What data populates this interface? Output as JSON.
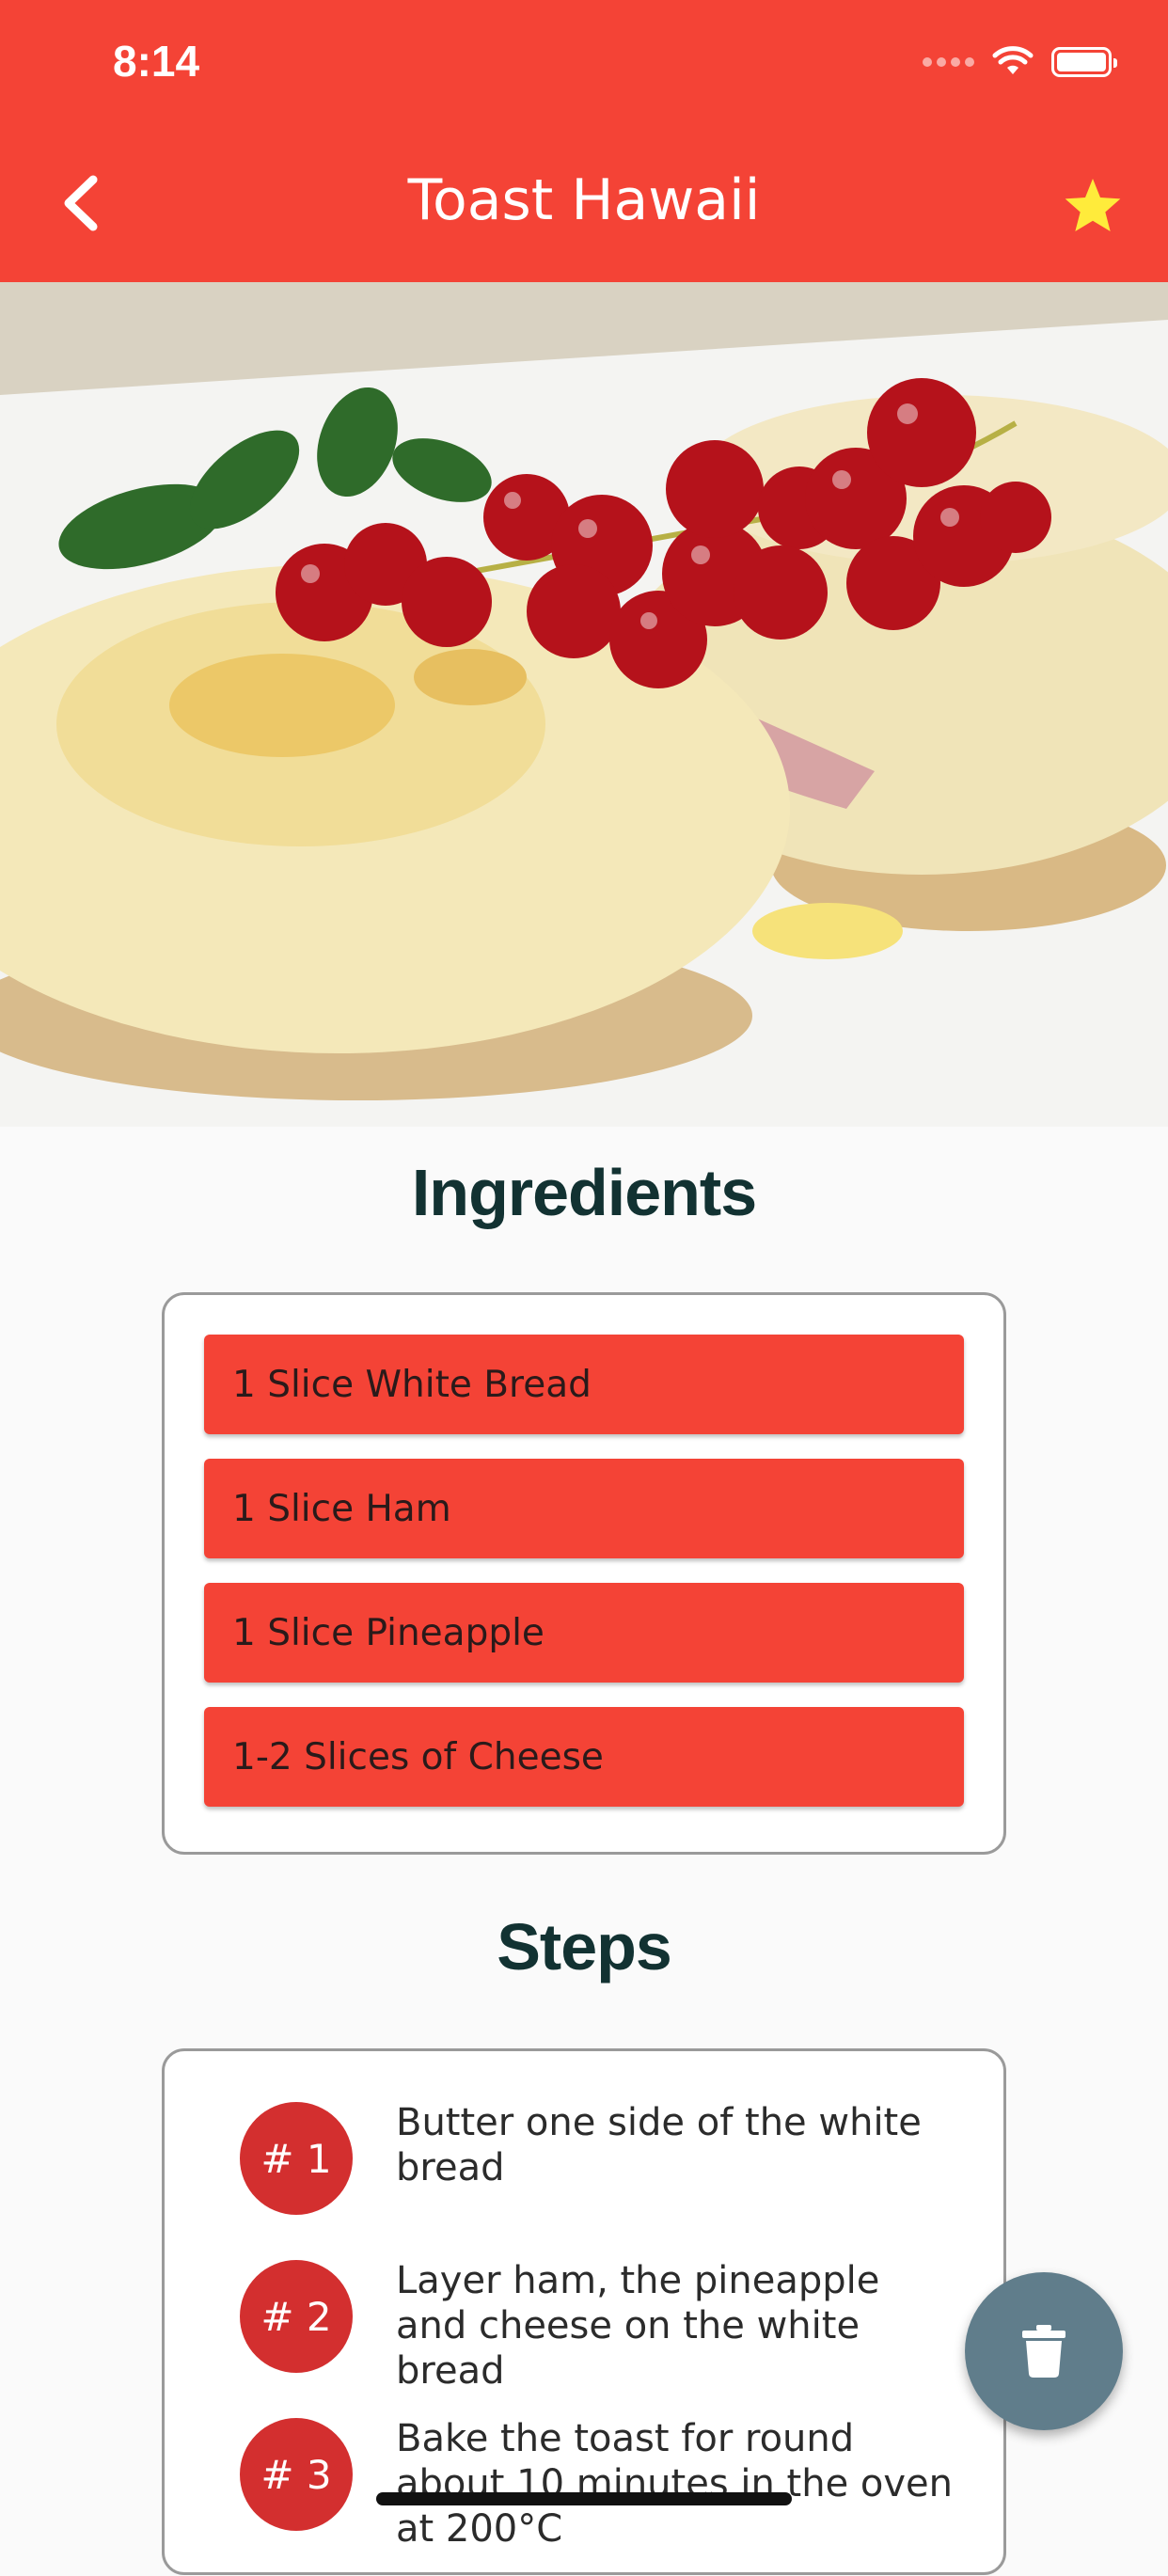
{
  "status_bar": {
    "time": "8:14"
  },
  "header": {
    "title": "Toast Hawaii"
  },
  "sections": {
    "ingredients_title": "Ingredients",
    "steps_title": "Steps"
  },
  "ingredients": [
    "1 Slice White Bread",
    "1 Slice Ham",
    "1 Slice Pineapple",
    "1-2 Slices of Cheese"
  ],
  "steps": [
    {
      "badge": "# 1",
      "text": "Butter one side of the white bread"
    },
    {
      "badge": "# 2",
      "text": "Layer ham, the pineapple and cheese on the white bread"
    },
    {
      "badge": "# 3",
      "text": "Bake the toast for round about 10 minutes in the oven at 200°C"
    }
  ],
  "icons": {
    "back": "chevron-left-icon",
    "favorite": "star-icon",
    "delete": "trash-icon"
  },
  "colors": {
    "primary": "#f44336",
    "badge": "#d32f2f",
    "heading": "#123232",
    "fab": "#607d8b",
    "star": "#ffeb3b"
  }
}
